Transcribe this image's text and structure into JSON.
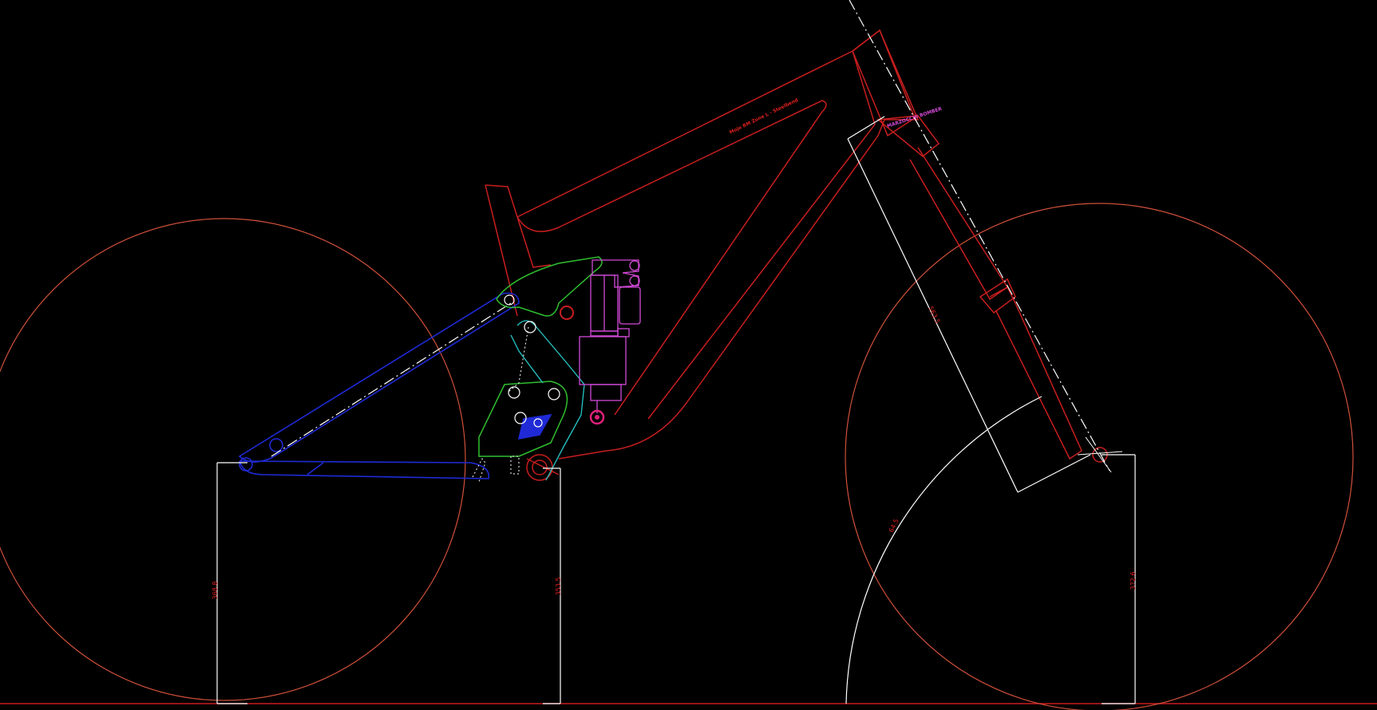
{
  "drawing": {
    "frame_label": "Mojo RM Zone L - Steelbend",
    "fork_label": "MARZOCCHI BOMBER",
    "dimensions": [
      {
        "id": "rear-axle-height",
        "text": "368.8"
      },
      {
        "id": "bb-height",
        "text": "353.5"
      },
      {
        "id": "front-axle-height",
        "text": "372.6"
      },
      {
        "id": "fork-length",
        "text": "563.5"
      },
      {
        "id": "head-angle",
        "text": "64.5"
      }
    ]
  },
  "colors": {
    "background": "#000000",
    "frame": "#c81e1e",
    "wheel": "#d0503a",
    "swingarm": "#1f2ad6",
    "linkage_green": "#2fbf2f",
    "linkage_cyan": "#27c6c6",
    "shock": "#d24ad6",
    "dimension": "#ffffff",
    "dim_text": "#e02020"
  }
}
